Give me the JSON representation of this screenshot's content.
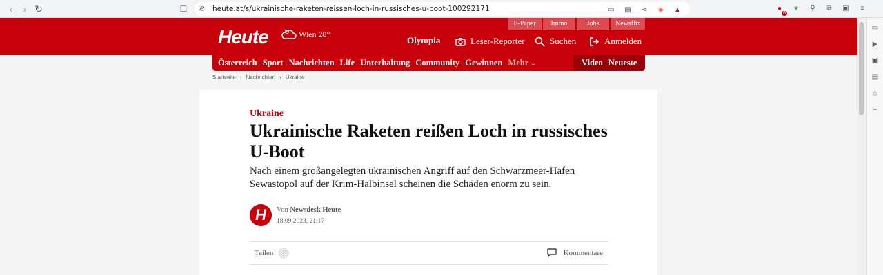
{
  "browser": {
    "url": "heute.at/s/ukrainische-raketen-reissen-loch-in-russisches-u-boot-100292171",
    "badge_count": "6"
  },
  "header": {
    "logo": "Heute",
    "weather": "Wien 28°",
    "top_links": [
      "E-Paper",
      "Immo",
      "Jobs",
      "Newsflix"
    ],
    "olympia": "Olympia",
    "reporter": "Leser-Reporter",
    "search": "Suchen",
    "login": "Anmelden"
  },
  "subnav": {
    "items": [
      "Österreich",
      "Sport",
      "Nachrichten",
      "Life",
      "Unterhaltung",
      "Community",
      "Gewinnen"
    ],
    "more": "Mehr",
    "video": "Video",
    "newest": "Neueste"
  },
  "breadcrumb": [
    "Startseite",
    "Nachrichten",
    "Ukraine"
  ],
  "article": {
    "kicker": "Ukraine",
    "title": "Ukrainische Raketen reißen Loch in russisches U-Boot",
    "lead": "Nach einem großangelegten ukrainischen Angriff auf den Schwarzmeer-Hafen Sewastopol auf der Krim-Halbinsel scheinen die Schäden enorm zu sein.",
    "avatar_letter": "H",
    "author_prefix": "Von",
    "author": "Newsdesk Heute",
    "date": "18.09.2023, 21:17",
    "share": "Teilen",
    "comments": "Kommentare"
  },
  "colors": {
    "brand": "#c8000a",
    "brand_dark": "#9a0007"
  }
}
